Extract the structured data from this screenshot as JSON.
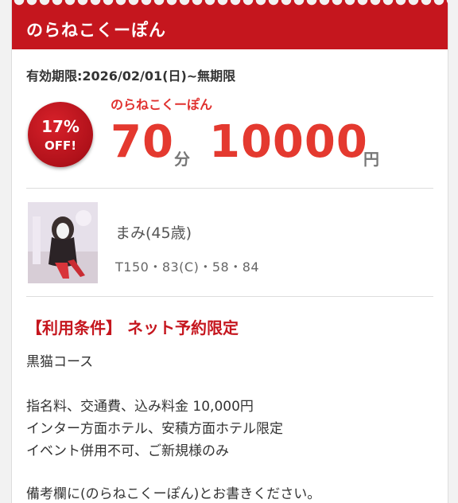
{
  "header": {
    "title": "のらねこくーぽん"
  },
  "coupon": {
    "validity": "有効期限:2026/02/01(日)~無期限",
    "badge_percent": "17%",
    "badge_off": "OFF!",
    "name": "のらねこくーぽん",
    "duration": "70",
    "duration_unit": "分",
    "price": "10000",
    "price_unit": "円"
  },
  "staff": {
    "name": "まみ(45歳)",
    "stats": "T150・83(C)・58・84"
  },
  "conditions": {
    "heading": "【利用条件】 ネット予約限定",
    "lines": [
      "黒猫コース",
      "指名料、交通費、込み料金 10,000円",
      "インター方面ホテル、安積方面ホテル限定",
      "イベント併用不可、ご新規様のみ",
      "備考欄に(のらねこくーぽん)とお書きください。"
    ]
  },
  "colors": {
    "accent": "#c5161e",
    "price": "#e4392f",
    "background": "#f2f2f2"
  }
}
